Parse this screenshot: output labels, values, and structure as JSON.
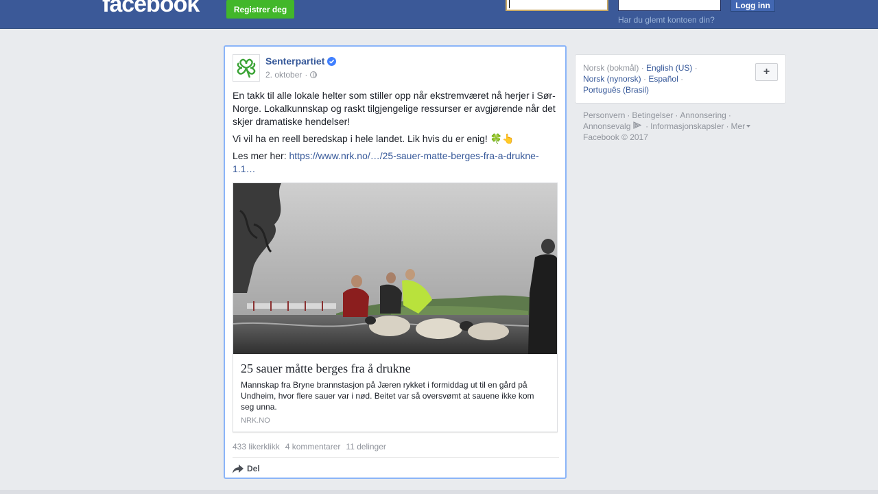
{
  "header": {
    "logo": "facebook",
    "register_label": "Registrer deg",
    "login_label": "Logg inn",
    "forgot_label": "Har du glemt kontoen din?"
  },
  "post": {
    "page_name": "Senterpartiet",
    "date": "2. oktober",
    "dot": "·",
    "paragraph1": "En takk til alle lokale helter som stiller opp når ekstremværet nå herjer i Sør-Norge. Lokalkunnskap og raskt tilgjengelige ressurser er avgjørende når det skjer dramatiske hendelser!",
    "paragraph2": "Vi vil ha en reell beredskap i hele landet. Lik hvis du er enig! 🍀👆",
    "read_more_prefix": "Les mer her: ",
    "read_more_link": "https://www.nrk.no/…/25-sauer-matte-berges-fra-a-drukne-1.1…",
    "link_card": {
      "title": "25 sauer måtte berges fra å drukne",
      "description": "Mannskap fra Bryne brannstasjon på Jæren rykket i formiddag ut til en gård på Undheim, hvor flere sauer var i nød. Beitet var så oversvømt at sauene ikke kom seg unna.",
      "domain": "NRK.NO"
    },
    "stats": {
      "likes": "433 likerklikk",
      "comments": "4 kommentarer",
      "shares": "11 delinger"
    },
    "share_label": "Del"
  },
  "languages": {
    "current": "Norsk (bokmål)",
    "english": "English (US)",
    "nynorsk": "Norsk (nynorsk)",
    "spanish": "Español",
    "portuguese": "Português (Brasil)",
    "sep": "·",
    "plus": "+"
  },
  "footer": {
    "privacy": "Personvern",
    "terms": "Betingelser",
    "ads": "Annonsering",
    "ad_choices": "Annonsevalg",
    "cookies": "Informasjonskapsler",
    "more": "Mer",
    "copyright": "Facebook © 2017"
  },
  "colors": {
    "brand_blue": "#3b5998",
    "register_green": "#42b72a",
    "link_blue": "#365899",
    "muted": "#90949c"
  }
}
